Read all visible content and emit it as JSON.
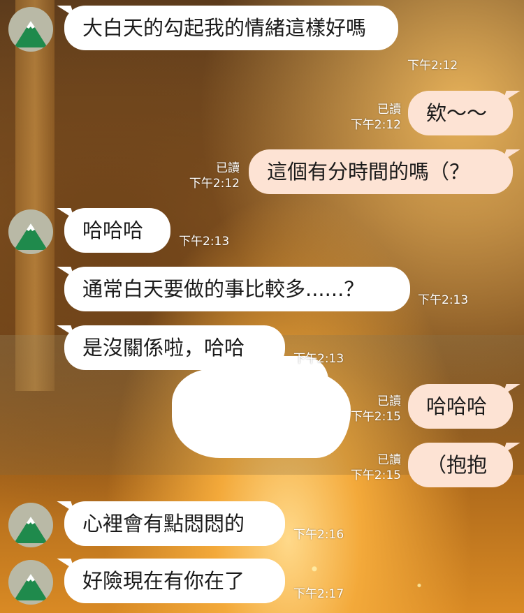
{
  "messages": [
    {
      "side": "in",
      "text": "大白天的勾起我的情緒這樣好嗎",
      "time": "下午2:12"
    },
    {
      "side": "out",
      "text": "欸～～",
      "read": "已讀",
      "time": "下午2:12"
    },
    {
      "side": "out",
      "text": "這個有分時間的嗎（？",
      "read": "已讀",
      "time": "下午2:12"
    },
    {
      "side": "in",
      "text": "哈哈哈",
      "time": "下午2:13"
    },
    {
      "side": "in",
      "text": "通常白天要做的事比較多......？",
      "time": "下午2:13"
    },
    {
      "side": "in",
      "text": "是沒關係啦，哈哈",
      "time": "下午2:13"
    },
    {
      "side": "out",
      "text": "哈哈哈",
      "read": "已讀",
      "time": "下午2:15"
    },
    {
      "side": "out",
      "text": "（抱抱",
      "read": "已讀",
      "time": "下午2:15"
    },
    {
      "side": "in",
      "text": "心裡會有點悶悶的",
      "time": "下午2:16"
    },
    {
      "side": "in",
      "text": "好險現在有你在了",
      "time": "下午2:17"
    }
  ],
  "colors": {
    "incoming_bubble": "#ffffff",
    "outgoing_bubble": "#fde3d4",
    "avatar_bg": "#b9b9a6",
    "avatar_mountain": "#1f8a4c"
  },
  "icons": {
    "avatar": "green-mountain-avatar-icon"
  }
}
